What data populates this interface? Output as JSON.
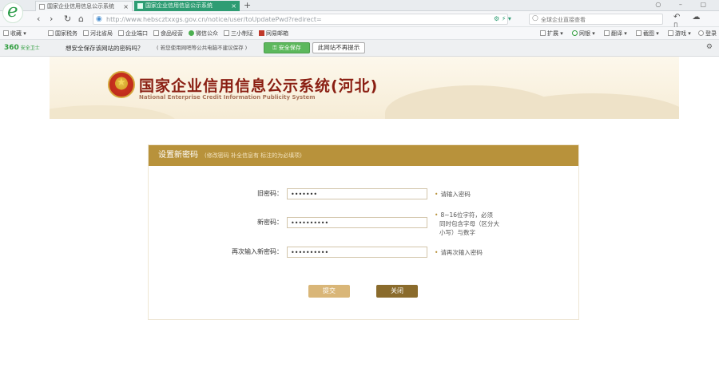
{
  "browser": {
    "logo_glyph": "e",
    "tabs": [
      {
        "label": "国家企业信用信息公示系统",
        "close": "×",
        "active": false
      },
      {
        "label": "国家企业信用信息公示系统",
        "close": "×",
        "active": true
      }
    ],
    "new_tab": "+",
    "window_controls": "○ – ▢",
    "nav": {
      "back": "‹",
      "forward": "›",
      "refresh": "↻",
      "home": "⌂"
    },
    "url": "http://www.hebscztxxgs.gov.cn/notice/user/toUpdatePwd?redirect=",
    "url_tools": "⚙ ⚡ ▾",
    "search_placeholder": "全球企业直接查看",
    "nav_right_icons": "↶ ☁ ▯"
  },
  "bookmarks": {
    "left": [
      {
        "label": "收藏 ▾"
      },
      {
        "label": "国家税务"
      },
      {
        "label": "河北省局"
      },
      {
        "label": "企业端口"
      },
      {
        "label": "食品经营"
      },
      {
        "label": "微信公众"
      },
      {
        "label": "三小制证"
      },
      {
        "label": "网易邮箱"
      }
    ],
    "right": [
      {
        "label": "扩展 ▾"
      },
      {
        "label": "网银 ▾"
      },
      {
        "label": "翻译 ▾"
      },
      {
        "label": "截图 ▾"
      },
      {
        "label": "游戏 ▾"
      },
      {
        "label": "登录"
      }
    ]
  },
  "security_bar": {
    "brand": "360",
    "brand_sub": "安全卫士",
    "question": "想安全保存该网站的密码吗？",
    "note": "( 若您使用网吧等公共电脑不建议保存 )",
    "save_button": "安全保存",
    "no_more_button": "此网站不再提示",
    "gear": "⚙"
  },
  "site": {
    "emblem_glyph": "★",
    "title": "国家企业信用信息公示系统(河北)",
    "subtitle": "National Enterprise Credit Information Publicity System"
  },
  "form": {
    "title": "设置新密码",
    "hint": "(修改密码 补全信息有  标注的为必填项)",
    "fields": [
      {
        "label": "旧密码：",
        "value": "•••••••",
        "hint": "请输入密码"
      },
      {
        "label": "新密码：",
        "value": "••••••••••",
        "hint_lines": [
          "8~16位字符，必须",
          "同时包含字母（区分大",
          "小写）与数字"
        ]
      },
      {
        "label": "再次输入新密码：",
        "value": "••••••••••",
        "hint": "请再次输入密码"
      }
    ],
    "hint_dot": "•",
    "submit": "提交",
    "close": "关闭"
  },
  "colors": {
    "active_tab": "#2e9c73",
    "panel_header": "#b8923b",
    "submit_button": "#d9b678",
    "close_button": "#8a6b2c",
    "title_red": "#8a1e12"
  }
}
